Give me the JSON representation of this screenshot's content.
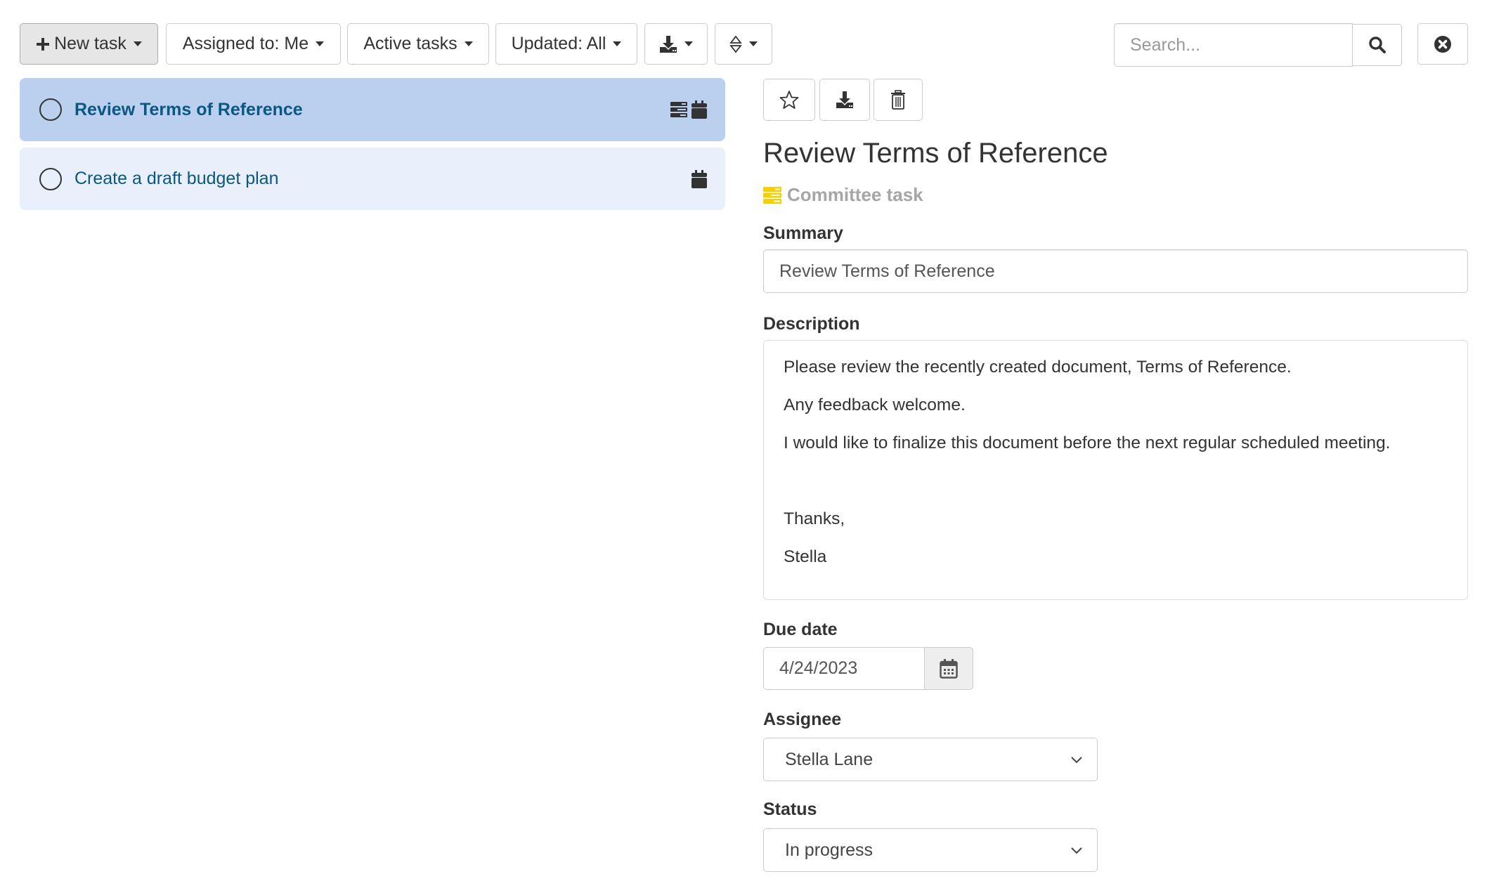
{
  "toolbar": {
    "new_task_label": "New task",
    "assigned_label": "Assigned to: Me",
    "active_label": "Active tasks",
    "updated_label": "Updated: All",
    "search_placeholder": "Search..."
  },
  "tasks": [
    {
      "title": "Review Terms of Reference",
      "selected": true,
      "icons": [
        "category-icon",
        "calendar-icon"
      ]
    },
    {
      "title": "Create a draft budget plan",
      "selected": false,
      "icons": [
        "calendar-icon"
      ]
    }
  ],
  "detail": {
    "title": "Review Terms of Reference",
    "category": "Committee task",
    "category_color": "#f5cf00",
    "summary_label": "Summary",
    "summary_value": "Review Terms of Reference",
    "description_label": "Description",
    "description_lines": [
      "Please review the recently created document, Terms of Reference.",
      "Any feedback welcome.",
      "I would like to finalize this document before the next regular scheduled meeting.",
      "",
      "Thanks,",
      "Stella"
    ],
    "due_label": "Due date",
    "due_value": "4/24/2023",
    "assignee_label": "Assignee",
    "assignee_value": "Stella Lane",
    "status_label": "Status",
    "status_value": "In progress"
  },
  "colors": {
    "selected_row": "#bad0ee",
    "row": "#e9f0fb",
    "task_text": "#0b5783"
  }
}
